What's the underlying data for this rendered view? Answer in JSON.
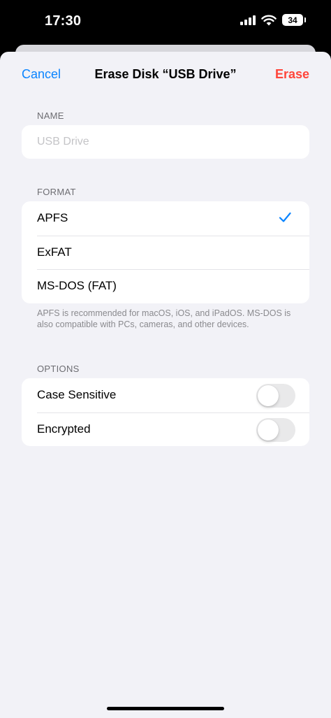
{
  "status_bar": {
    "time": "17:30",
    "battery": "34",
    "icons": [
      "signal-icon",
      "wifi-icon",
      "battery-icon"
    ]
  },
  "nav": {
    "cancel_label": "Cancel",
    "title": "Erase Disk “USB Drive”",
    "erase_label": "Erase"
  },
  "name_section": {
    "header": "NAME",
    "placeholder": "USB Drive",
    "value": ""
  },
  "format_section": {
    "header": "FORMAT",
    "options": [
      {
        "label": "APFS",
        "selected": true
      },
      {
        "label": "ExFAT",
        "selected": false
      },
      {
        "label": "MS-DOS (FAT)",
        "selected": false
      }
    ],
    "footer": "APFS is recommended for macOS, iOS, and iPadOS. MS-DOS is also compatible with PCs, cameras, and other devices."
  },
  "options_section": {
    "header": "OPTIONS",
    "toggles": [
      {
        "label": "Case Sensitive",
        "on": false
      },
      {
        "label": "Encrypted",
        "on": false
      }
    ]
  },
  "colors": {
    "accent": "#0a84ff",
    "destructive": "#ff453a",
    "background": "#f2f2f7"
  }
}
